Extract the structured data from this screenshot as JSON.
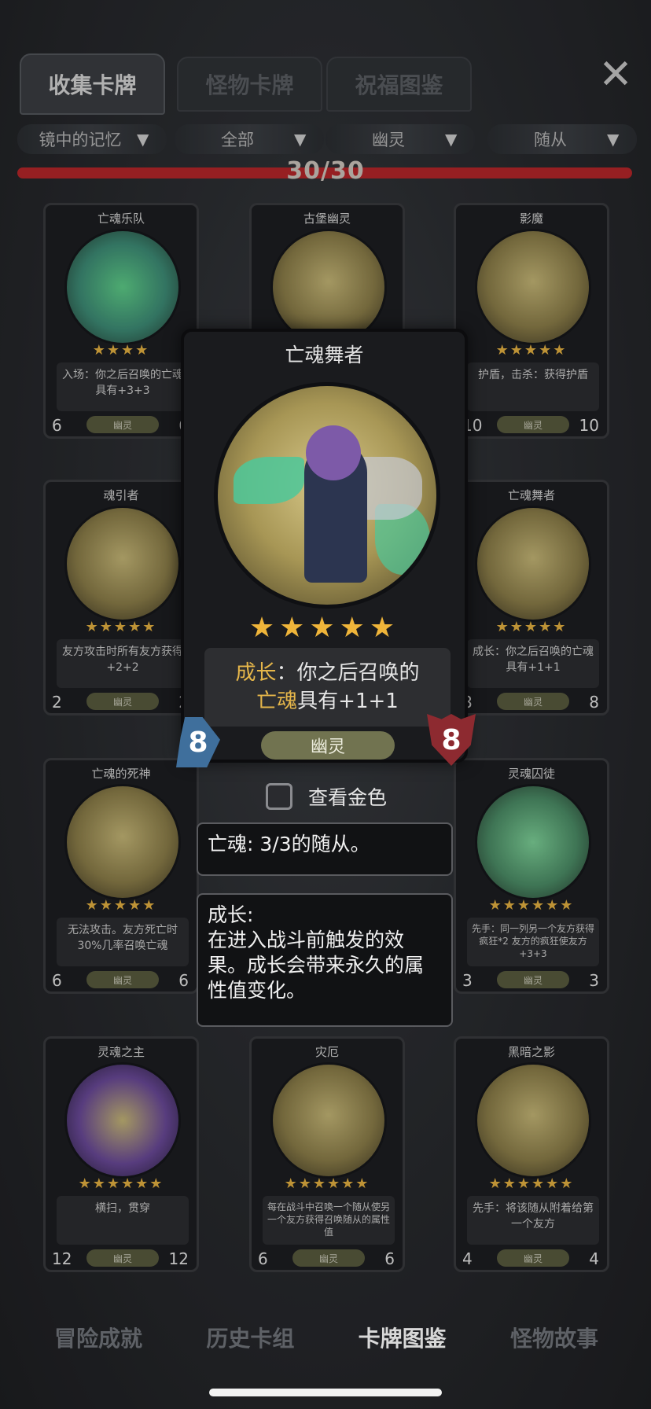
{
  "tabs": [
    {
      "label": "收集卡牌",
      "active": true
    },
    {
      "label": "怪物卡牌",
      "active": false
    },
    {
      "label": "祝福图鉴",
      "active": false
    }
  ],
  "close_icon": "close-icon",
  "filters": [
    "镜中的记忆",
    "全部",
    "幽灵",
    "随从"
  ],
  "progress": {
    "text": "30/30",
    "value": 1.0
  },
  "cards": [
    {
      "title": "亡魂乐队",
      "desc": "入场：你之后召唤的亡魂具有+3+3",
      "stars": "★★★★",
      "atk": "6",
      "hp": "6",
      "tag": "幽灵"
    },
    {
      "title": "古堡幽灵",
      "desc": "",
      "stars": "",
      "atk": "",
      "hp": "",
      "tag": ""
    },
    {
      "title": "影魔",
      "desc": "护盾，击杀：获得护盾",
      "stars": "★★★★★",
      "atk": "10",
      "hp": "10",
      "tag": "幽灵"
    },
    {
      "title": "魂引者",
      "desc": "友方攻击时所有友方获得+2+2",
      "stars": "★★★★★",
      "atk": "2",
      "hp": "2",
      "tag": "幽灵"
    },
    {
      "title": "",
      "desc": "",
      "stars": "",
      "atk": "",
      "hp": "",
      "tag": ""
    },
    {
      "title": "亡魂舞者",
      "desc": "成长：你之后召唤的亡魂具有+1+1",
      "stars": "★★★★★",
      "atk": "8",
      "hp": "8",
      "tag": "幽灵"
    },
    {
      "title": "亡魂的死神",
      "desc": "无法攻击。友方死亡时30%几率召唤亡魂",
      "stars": "★★★★★",
      "atk": "6",
      "hp": "6",
      "tag": "幽灵"
    },
    {
      "title": "",
      "desc": "",
      "stars": "",
      "atk": "",
      "hp": "",
      "tag": ""
    },
    {
      "title": "灵魂囚徒",
      "desc": "先手：同一列另一个友方获得疯狂*2 友方的疯狂使友方+3+3",
      "stars": "★★★★★★",
      "atk": "3",
      "hp": "3",
      "tag": "幽灵"
    },
    {
      "title": "灵魂之主",
      "desc": "横扫，贯穿",
      "stars": "★★★★★★",
      "atk": "12",
      "hp": "12",
      "tag": "幽灵"
    },
    {
      "title": "灾厄",
      "desc": "每在战斗中召唤一个随从使另一个友方获得召唤随从的属性值",
      "stars": "★★★★★★",
      "atk": "6",
      "hp": "6",
      "tag": "幽灵"
    },
    {
      "title": "黑暗之影",
      "desc": "先手：将该随从附着给第一个友方",
      "stars": "★★★★★★",
      "atk": "4",
      "hp": "4",
      "tag": "幽灵"
    }
  ],
  "featured": {
    "title": "亡魂舞者",
    "stars": "★★★★★",
    "desc_part1": "成长",
    "desc_part2": "：你之后召唤的",
    "desc_part3": "亡魂",
    "desc_part4": "具有+1+1",
    "atk": "8",
    "hp": "8",
    "tag": "幽灵"
  },
  "golden_toggle": {
    "label": "查看金色",
    "checked": false
  },
  "tooltips": {
    "tip1": "亡魂: 3/3的随从。",
    "tip2_title": "成长:",
    "tip2_body": "在进入战斗前触发的效果。成长会带来永久的属性值变化。"
  },
  "bottom_nav": [
    {
      "label": "冒险成就",
      "active": false
    },
    {
      "label": "历史卡组",
      "active": false
    },
    {
      "label": "卡牌图鉴",
      "active": true
    },
    {
      "label": "怪物故事",
      "active": false
    }
  ]
}
